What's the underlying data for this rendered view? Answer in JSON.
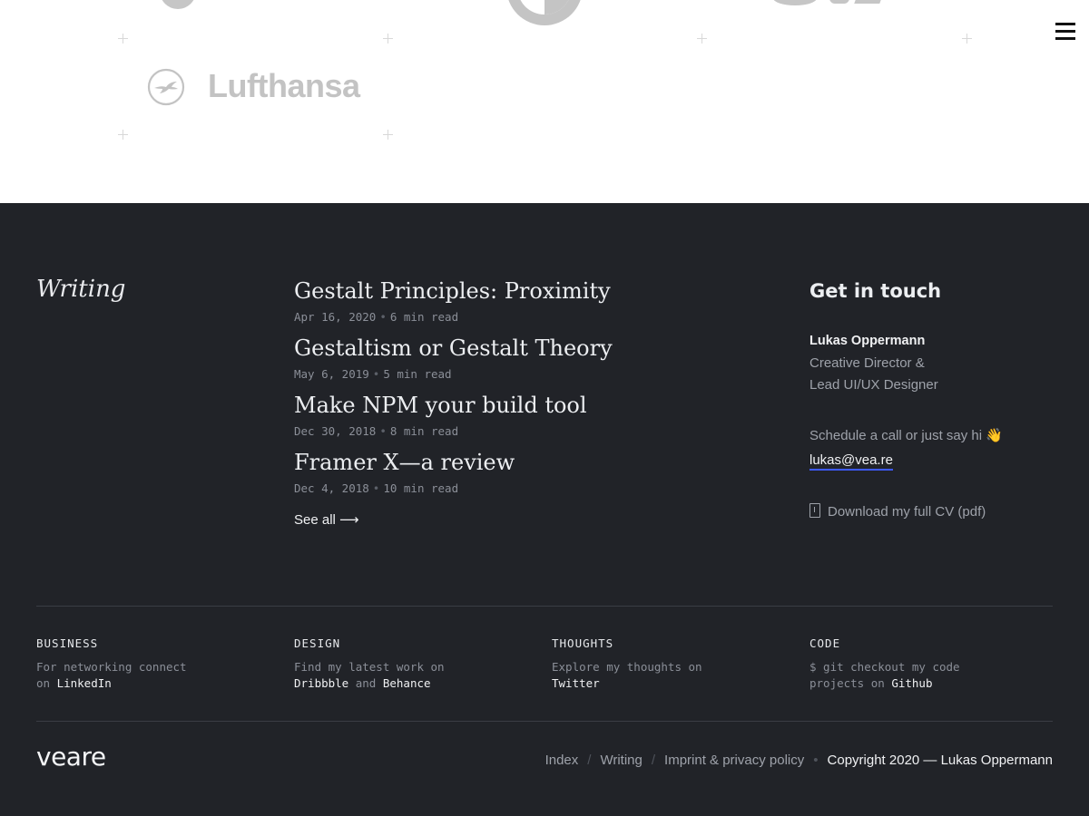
{
  "logos": {
    "lufthansa_text": "Lufthansa"
  },
  "writing": {
    "section_title": "Writing",
    "posts": [
      {
        "title": "Gestalt Principles: Proximity",
        "date": "Apr 16, 2020",
        "read": "6 min read"
      },
      {
        "title": "Gestaltism or Gestalt Theory",
        "date": "May 6, 2019",
        "read": "5 min read"
      },
      {
        "title": "Make NPM your build tool",
        "date": "Dec 30, 2018",
        "read": "8 min read"
      },
      {
        "title": "Framer X—a review",
        "date": "Dec 4, 2018",
        "read": "10 min read"
      }
    ],
    "see_all": "See all ⟶"
  },
  "contact": {
    "title": "Get in touch",
    "name": "Lukas Oppermann",
    "role_line1": "Creative Director &",
    "role_line2": "Lead UI/UX Designer",
    "schedule": "Schedule a call or just say hi 👋",
    "email": "lukas@vea.re",
    "cv": "Download my full CV (pdf)"
  },
  "columns": [
    {
      "head": "BUSINESS",
      "line1": "For networking connect",
      "prefix2": "on ",
      "link1": "LinkedIn",
      "mid": "",
      "link2": ""
    },
    {
      "head": "DESIGN",
      "line1": "Find my latest work on",
      "prefix2": "",
      "link1": "Dribbble",
      "mid": " and ",
      "link2": "Behance"
    },
    {
      "head": "THOUGHTS",
      "line1": "Explore my thoughts on",
      "prefix2": "",
      "link1": "Twitter",
      "mid": "",
      "link2": ""
    },
    {
      "head": "CODE",
      "line1": "$ git checkout my code",
      "prefix2": "projects on ",
      "link1": "Github",
      "mid": "",
      "link2": ""
    }
  ],
  "footer": {
    "brand": "veare",
    "nav": [
      "Index",
      "Writing",
      "Imprint & privacy policy"
    ],
    "separator": "/",
    "dot": "•",
    "copyright": "Copyright 2020 — Lukas Oppermann"
  },
  "colors": {
    "dark_bg": "#212328",
    "email_underline": "#3d5afe",
    "logo_gray": "#c3c3c3"
  }
}
